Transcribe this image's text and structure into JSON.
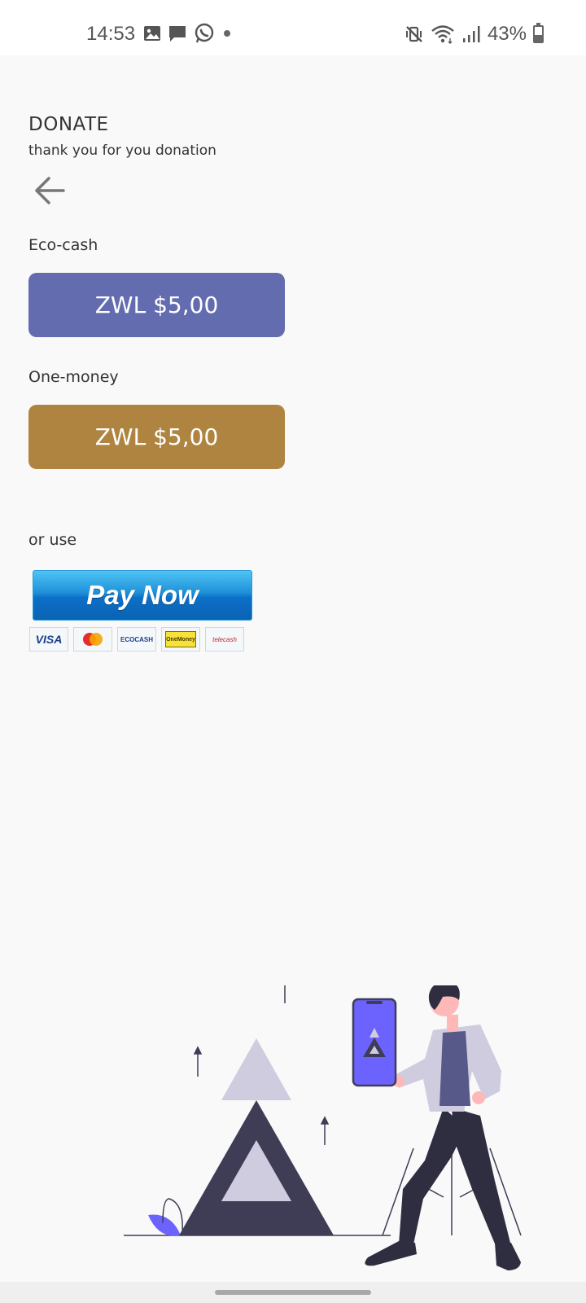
{
  "status_bar": {
    "time": "14:53",
    "battery_percent": "43%",
    "battery_level": 0.43,
    "left_icons": [
      "gallery-icon",
      "message-icon",
      "whatsapp-icon",
      "dot-icon"
    ],
    "right_icons": [
      "mute-vibrate-icon",
      "wifi-icon",
      "signal-icon",
      "battery-icon"
    ]
  },
  "header": {
    "title": "DONATE",
    "subtitle": "thank you for you donation"
  },
  "ecocash": {
    "label": "Eco-cash",
    "amount": "ZWL $5,00",
    "color": "#636caf"
  },
  "onemoney": {
    "label": "One-money",
    "amount": "ZWL $5,00",
    "color": "#ae8440"
  },
  "alternative": {
    "label": "or use",
    "paynow_text": "Pay Now",
    "payment_logos": [
      "VISA",
      "mastercard",
      "ECOCASH",
      "OneMoney",
      "telecash"
    ]
  },
  "illustration": {
    "name": "man-with-phone-illustration",
    "accent_color": "#6c63ff"
  }
}
